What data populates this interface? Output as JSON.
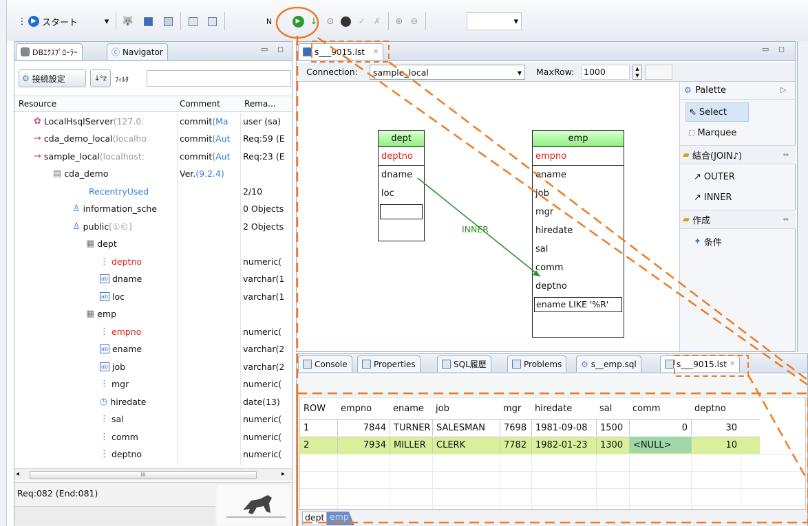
{
  "toolbar": {
    "start_label": "スタート",
    "combo_value": ""
  },
  "left_view": {
    "tabs": [
      "DBｴｸｽﾌﾟﾛｰﾗｰ",
      "Navigator"
    ],
    "connect_button": "接続設定",
    "filter_label": "ﾌｨﾙﾀ",
    "filter_value": "",
    "columns": [
      "Resource",
      "Comment",
      "Rema..."
    ],
    "rows": [
      {
        "name": "LocalHsqlServer",
        "suffix": "(127.0.",
        "comment": "commit",
        "comment_suffix": " (Ma",
        "remark": "user (sa)"
      },
      {
        "name": "cda_demo_local",
        "suffix": "(localho",
        "comment": "commit",
        "comment_suffix": " (Aut",
        "remark": "Req:59 (E"
      },
      {
        "name": "sample_local",
        "suffix": "(localhost:",
        "comment": "commit",
        "comment_suffix": " (Aut",
        "remark": "Req:23 (E"
      },
      {
        "name": "cda_demo",
        "suffix": "",
        "comment": "Ver.",
        "comment_suffix": " (9.2.4)",
        "remark": ""
      },
      {
        "name": "RecentryUsed",
        "suffix": "",
        "comment": "",
        "comment_suffix": "",
        "remark": "2/10"
      },
      {
        "name": "information_sche",
        "suffix": "",
        "comment": "",
        "comment_suffix": "",
        "remark": "0 Objects"
      },
      {
        "name": "public",
        "suffix": " [①©]",
        "comment": "",
        "comment_suffix": "",
        "remark": "2 Objects"
      },
      {
        "name": "dept",
        "suffix": "",
        "comment": "",
        "comment_suffix": "",
        "remark": ""
      },
      {
        "name": "deptno",
        "suffix": "",
        "comment": "",
        "comment_suffix": "",
        "remark": "numeric("
      },
      {
        "name": "dname",
        "suffix": "",
        "comment": "",
        "comment_suffix": "",
        "remark": "varchar(1"
      },
      {
        "name": "loc",
        "suffix": "",
        "comment": "",
        "comment_suffix": "",
        "remark": "varchar(1"
      },
      {
        "name": "emp",
        "suffix": "",
        "comment": "",
        "comment_suffix": "",
        "remark": ""
      },
      {
        "name": "empno",
        "suffix": "",
        "comment": "",
        "comment_suffix": "",
        "remark": "numeric("
      },
      {
        "name": "ename",
        "suffix": "",
        "comment": "",
        "comment_suffix": "",
        "remark": "varchar(2"
      },
      {
        "name": "job",
        "suffix": "",
        "comment": "",
        "comment_suffix": "",
        "remark": "varchar(2"
      },
      {
        "name": "mgr",
        "suffix": "",
        "comment": "",
        "comment_suffix": "",
        "remark": "numeric("
      },
      {
        "name": "hiredate",
        "suffix": "",
        "comment": "",
        "comment_suffix": "",
        "remark": "date(13)"
      },
      {
        "name": "sal",
        "suffix": "",
        "comment": "",
        "comment_suffix": "",
        "remark": "numeric("
      },
      {
        "name": "comm",
        "suffix": "",
        "comment": "",
        "comment_suffix": "",
        "remark": "numeric("
      },
      {
        "name": "deptno",
        "suffix": "",
        "comment": "",
        "comment_suffix": "",
        "remark": "numeric("
      }
    ],
    "hscroll_grip": "III",
    "status": "Req:082 (End:081)"
  },
  "editor": {
    "tab_label": "s___9015.lst",
    "connection_label": "Connection:",
    "connection_value": "sample_local",
    "maxrow_label": "MaxRow:",
    "maxrow_value": "1000",
    "tables": [
      {
        "title": "dept",
        "columns": [
          "deptno",
          "dname",
          "loc"
        ],
        "condition": ""
      },
      {
        "title": "emp",
        "columns": [
          "empno",
          "ename",
          "job",
          "mgr",
          "hiredate",
          "sal",
          "comm",
          "deptno"
        ],
        "condition": "ename LIKE '%R'"
      }
    ],
    "join_label": "INNER"
  },
  "palette": {
    "title": "Palette",
    "select": "Select",
    "marquee": "Marquee",
    "join_group": "結合(JOIN♪)",
    "outer": "OUTER",
    "inner": "INNER",
    "create_group": "作成",
    "condition": "条件"
  },
  "bottom": {
    "tabs": [
      "Console",
      "Properties",
      "SQL履歴",
      "Problems",
      "s__emp.sql",
      "s___9015.lst"
    ],
    "result_columns": [
      "ROW",
      "empno",
      "ename",
      "job",
      "mgr",
      "hiredate",
      "sal",
      "comm",
      "deptno"
    ],
    "result_rows": [
      [
        "1",
        "7844",
        "TURNER",
        "SALESMAN",
        "7698",
        "1981-09-08",
        "1500",
        "0",
        "30"
      ],
      [
        "2",
        "7934",
        "MILLER",
        "CLERK",
        "7782",
        "1982-01-23",
        "1300",
        "<NULL>",
        "10"
      ]
    ],
    "sheet_tabs": [
      "dept",
      "emp"
    ]
  },
  "colors": {
    "accent_orange": "#ee7b22",
    "highlight_row": "#d9ef9a",
    "null_cell": "#9fd7a8",
    "erd_header": "#8ef07d"
  }
}
